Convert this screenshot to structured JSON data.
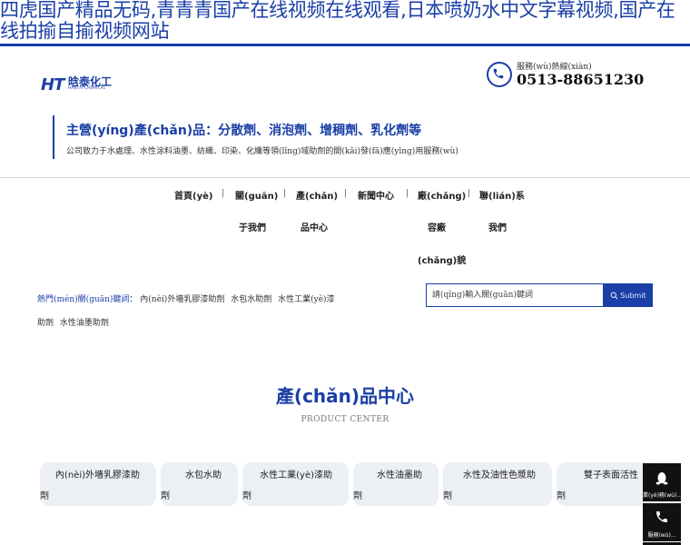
{
  "page_title": "四虎国产精品无码,青青青国产在线视频在线观看,日本喷奶水中文字幕视频,国产在线拍揄自揄视频网站",
  "logo": {
    "mark": "HT",
    "name": "晗泰化工",
    "subtitle": "HANTAI CHEMICAL"
  },
  "hotline": {
    "label": "服務(wù)熱線(xiàn)",
    "number": "0513-88651230"
  },
  "slogan": {
    "main": "主營(yíng)產(chǎn)品：分散劑、消泡劑、增稠劑、乳化劑等",
    "sub": "公司致力于水處理、水性涂料油墨、紡織、印染、化纖等領(lǐng)域助劑的開(kāi)發(fā)應(yīng)用服務(wù)"
  },
  "nav": {
    "home": "首頁(yè)",
    "about_1": "關(guān)",
    "about_2": "于我們",
    "products_1": "產(chǎn)",
    "products_2": "品中心",
    "news": "新聞中心",
    "factory_1": "廠(chǎng)",
    "factory_2": "容廠",
    "factory_3": "(chǎng)貌",
    "contact_1": "聯(lián)系",
    "contact_2": "我們",
    "separator": "|"
  },
  "hot_keywords": {
    "label": "熱門(mén)關(guān)鍵詞：",
    "items": [
      "內(nèi)外墻乳膠漆助劑",
      "水包水助劑",
      "水性工業(yè)漆助劑",
      "水性油墨助劑"
    ]
  },
  "search": {
    "placeholder": "請(qǐng)輸入關(guān)鍵詞",
    "button": "Submit"
  },
  "section": {
    "title": "產(chǎn)品中心",
    "subtitle": "PRODUCT CENTER"
  },
  "categories": [
    {
      "line1": "內(nèi)外墻乳膠漆助",
      "line2": "劑"
    },
    {
      "line1": "水包水助",
      "line2": "劑"
    },
    {
      "line1": "水性工業(yè)漆助",
      "line2": "劑"
    },
    {
      "line1": "水性油墨助",
      "line2": "劑"
    },
    {
      "line1": "水性及油性色漿助",
      "line2": "劑"
    },
    {
      "line1": "雙子表面活性",
      "line2": "劑"
    }
  ],
  "side_buttons": {
    "qq_label": "業(yè)務(wù)...",
    "phone_label": "服務(wù)..."
  },
  "colors": {
    "brand_blue": "#1a3fa6",
    "card_bg": "#eceff4",
    "side_bg": "#111111"
  }
}
